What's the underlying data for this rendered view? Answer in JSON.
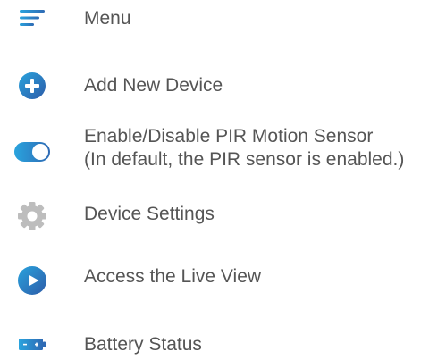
{
  "menu": {
    "items": [
      {
        "id": "menu",
        "label": "Menu",
        "icon": "hamburger-menu-icon"
      },
      {
        "id": "add",
        "label": "Add New Device",
        "icon": "plus-circle-icon"
      },
      {
        "id": "pir",
        "label_line1": "Enable/Disable PIR Motion Sensor",
        "label_line2": "(In default, the PIR sensor is enabled.)",
        "icon": "toggle-switch-icon"
      },
      {
        "id": "settings",
        "label": "Device Settings",
        "icon": "gear-icon"
      },
      {
        "id": "live",
        "label": "Access the Live View",
        "icon": "play-circle-icon"
      },
      {
        "id": "battery",
        "label": "Battery Status",
        "icon": "battery-icon"
      }
    ]
  },
  "colors": {
    "accent_blue": "#1e88c8",
    "accent_blue_dark": "#2e62b0",
    "gear_gray": "#bdbdbd",
    "text_gray": "#555555"
  }
}
